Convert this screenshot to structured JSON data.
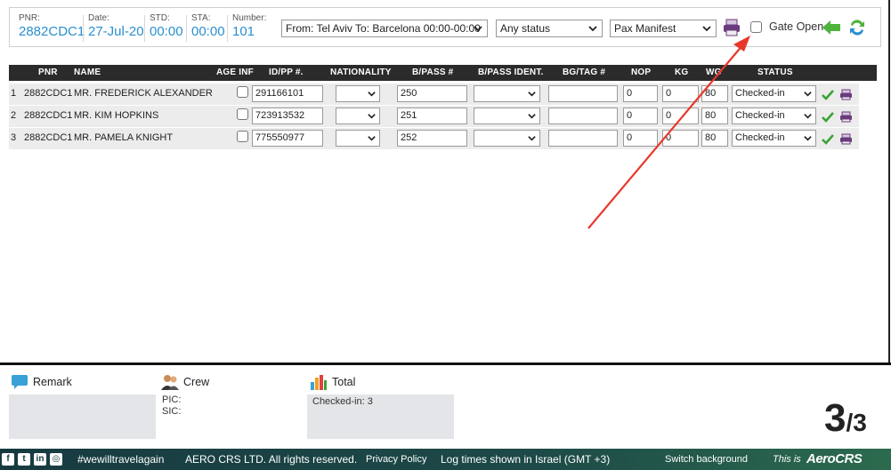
{
  "header": {
    "pnr_label": "PNR:",
    "pnr": "2882CDC1",
    "date_label": "Date:",
    "date": "27-Jul-20",
    "std_label": "STD:",
    "std": "00:00",
    "sta_label": "STA:",
    "sta": "00:00",
    "number_label": "Number:",
    "number": "101",
    "route_select": "From: Tel Aviv To: Barcelona 00:00-00:00",
    "status_select": "Any status",
    "report_select": "Pax Manifest",
    "gate_open_label": "Gate Open",
    "gate_open_checked": false
  },
  "table": {
    "columns": [
      "PNR",
      "NAME",
      "AGE INF",
      "ID/PP #.",
      "NATIONALITY",
      "B/PASS #",
      "B/PASS IDENT.",
      "BG/TAG #",
      "NOP",
      "KG",
      "WG",
      "STATUS"
    ],
    "rows": [
      {
        "idx": "1",
        "pnr": "2882CDC1",
        "name": "MR. FREDERICK ALEXANDER",
        "id": "291166101",
        "nationality": "",
        "bpass": "250",
        "bpass_ident": "",
        "bgtag": "",
        "nop": "0",
        "kg": "0",
        "wg": "80",
        "status": "Checked-in"
      },
      {
        "idx": "2",
        "pnr": "2882CDC1",
        "name": "MR. KIM HOPKINS",
        "id": "723913532",
        "nationality": "",
        "bpass": "251",
        "bpass_ident": "",
        "bgtag": "",
        "nop": "0",
        "kg": "0",
        "wg": "80",
        "status": "Checked-in"
      },
      {
        "idx": "3",
        "pnr": "2882CDC1",
        "name": "MR. PAMELA KNIGHT",
        "id": "775550977",
        "nationality": "",
        "bpass": "252",
        "bpass_ident": "",
        "bgtag": "",
        "nop": "0",
        "kg": "0",
        "wg": "80",
        "status": "Checked-in"
      }
    ]
  },
  "bottom": {
    "remark_title": "Remark",
    "crew_title": "Crew",
    "crew_pic": "PIC:",
    "crew_sic": "SIC:",
    "total_title": "Total",
    "total_checked": "Checked-in: 3",
    "counter_big": "3",
    "counter_small": "/3"
  },
  "footer": {
    "hashtag": "#wewilltravelagain",
    "copyright": "AERO CRS LTD. All rights reserved.",
    "privacy": "Privacy Policy",
    "times": "Log times shown in Israel (GMT +3)",
    "switch_bg": "Switch background",
    "this_is": "This is",
    "brand": "AeroCRS"
  },
  "colors": {
    "accent_blue": "#2a8fd0",
    "header_bar": "#2b2b2b",
    "row_bg": "#ececec",
    "check_green": "#3aa335",
    "print_purple": "#6b3a7d",
    "annotation_red": "#e8372a",
    "footer_dark": "#173a40"
  },
  "icons": [
    "print-icon",
    "back-arrow-icon",
    "refresh-icon",
    "check-icon",
    "remark-icon",
    "crew-icon",
    "total-chart-icon",
    "facebook-icon",
    "twitter-icon",
    "linkedin-icon",
    "instagram-icon"
  ]
}
